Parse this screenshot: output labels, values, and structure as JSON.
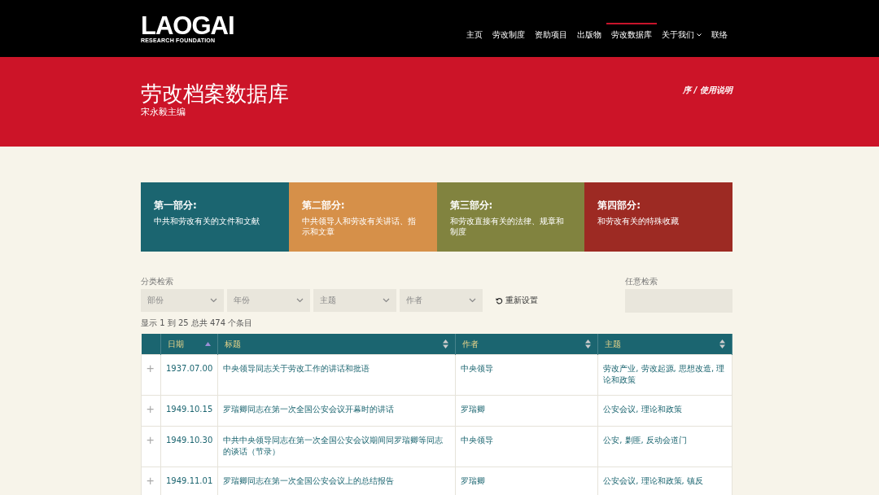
{
  "logo": {
    "name": "LAOGAI",
    "tagline": "RESEARCH FOUNDATION"
  },
  "nav": [
    {
      "label": "主页",
      "selected": false,
      "dropdown": false
    },
    {
      "label": "劳改制度",
      "selected": false,
      "dropdown": false
    },
    {
      "label": "资助项目",
      "selected": false,
      "dropdown": false
    },
    {
      "label": "出版物",
      "selected": false,
      "dropdown": false
    },
    {
      "label": "劳改数据库",
      "selected": true,
      "dropdown": false
    },
    {
      "label": "关于我们",
      "selected": false,
      "dropdown": true
    },
    {
      "label": "联络",
      "selected": false,
      "dropdown": false
    }
  ],
  "banner": {
    "title": "劳改档案数据库",
    "subtitle": "宋永毅主编",
    "links": "序 / 使用说明"
  },
  "sections": [
    {
      "title": "第一部分:",
      "desc": "中共和劳改有关的文件和文献",
      "color": "#1b6570"
    },
    {
      "title": "第二部分:",
      "desc": "中共领导人和劳改有关讲话、指示和文章",
      "color": "#d69049"
    },
    {
      "title": "第三部分:",
      "desc": "和劳改直接有关的法律、规章和制度",
      "color": "#81833f"
    },
    {
      "title": "第四部分:",
      "desc": "和劳改有关的特殊收藏",
      "color": "#9d2a23"
    }
  ],
  "filters": {
    "label": "分类检索",
    "selects": [
      "部份",
      "年份",
      "主题",
      "作者"
    ],
    "reset": "重新设置",
    "search_label": "任意检索"
  },
  "count": "显示 1 到 25 总共 474 个条目",
  "table": {
    "columns": [
      {
        "label": "日期",
        "sorted": true
      },
      {
        "label": "标题",
        "sorted": false
      },
      {
        "label": "作者",
        "sorted": false
      },
      {
        "label": "主题",
        "sorted": false
      }
    ],
    "rows": [
      {
        "expand": "+",
        "cells": [
          "1937.07.00",
          "中央领导同志关于劳改工作的讲话和批语",
          "中央领导",
          "劳改产业, 劳改起源, 思想改造, 理论和政策"
        ]
      },
      {
        "expand": "+",
        "cells": [
          "1949.10.15",
          "罗瑞卿同志在第一次全国公安会议开幕时的讲话",
          "罗瑞卿",
          "公安会议, 理论和政策"
        ]
      },
      {
        "expand": "+",
        "cells": [
          "1949.10.30",
          "中共中央领导同志在第一次全国公安会议期间同罗瑞卿等同志的谈话（节录）",
          "中央领导",
          "公安, 剿匪, 反动会道门"
        ]
      },
      {
        "expand": "+",
        "cells": [
          "1949.11.01",
          "罗瑞卿同志在第一次全国公安会议上的总结报告",
          "罗瑞卿",
          "公安会议, 理论和政策, 镇反"
        ]
      }
    ]
  }
}
